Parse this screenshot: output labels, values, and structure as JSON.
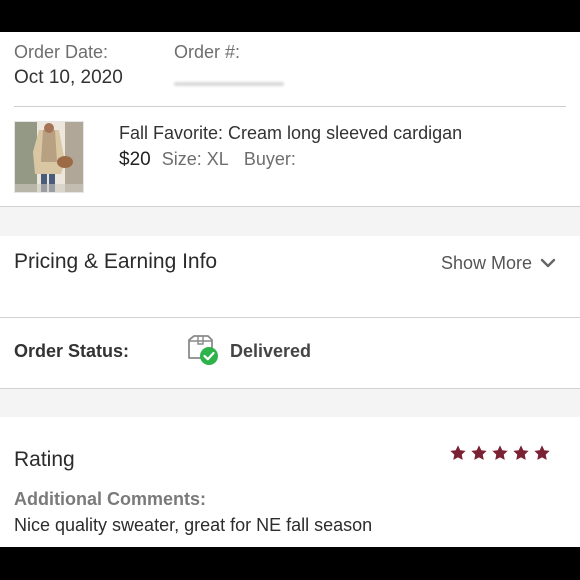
{
  "order": {
    "date_label": "Order Date:",
    "date_value": "Oct 10, 2020",
    "number_label": "Order #:"
  },
  "item": {
    "title": "Fall Favorite: Cream long sleeved cardigan",
    "price": "$20",
    "size_label": "Size:",
    "size_value": "XL",
    "buyer_label": "Buyer:"
  },
  "pricing": {
    "title": "Pricing & Earning Info",
    "show_more_label": "Show More",
    "chevron_icon": "chevron-down-icon"
  },
  "status": {
    "label": "Order Status:",
    "value": "Delivered",
    "icon": "package-delivered-icon"
  },
  "rating": {
    "title": "Rating",
    "stars": 5,
    "max_stars": 5,
    "star_color": "#7a2233",
    "comments_label": "Additional Comments:",
    "comments_text": "Nice quality sweater, great for NE fall season"
  },
  "colors": {
    "accent": "#7a2233",
    "check_green": "#2eb34a"
  }
}
